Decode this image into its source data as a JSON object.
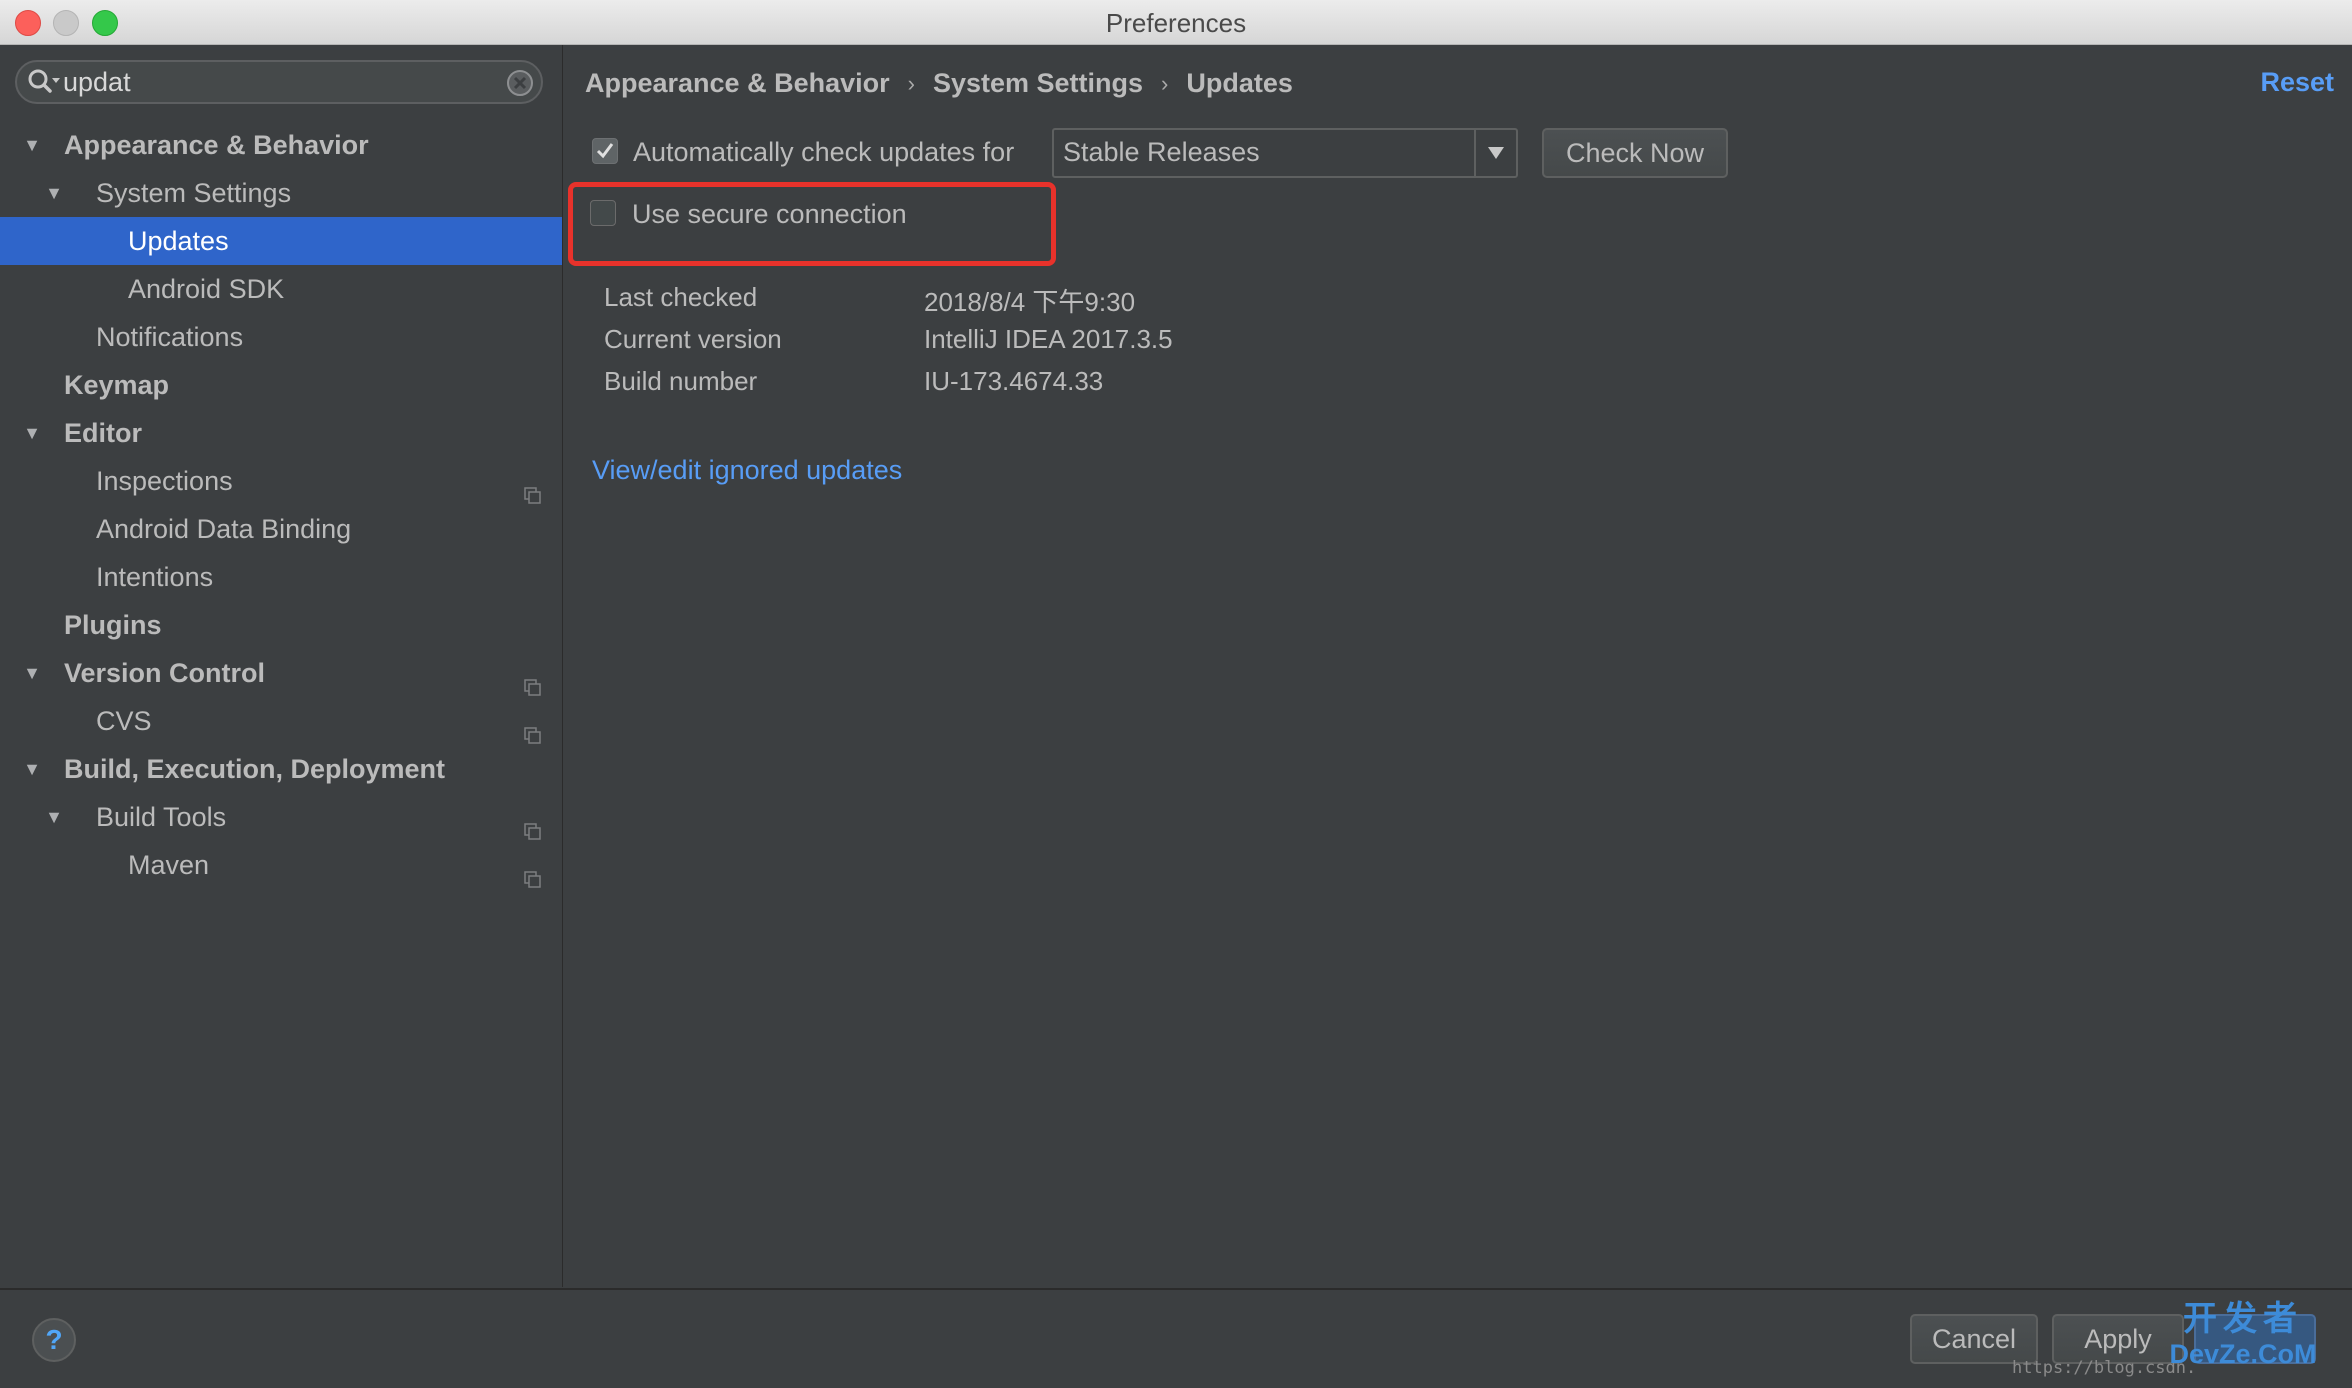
{
  "window": {
    "title": "Preferences"
  },
  "sidebar": {
    "search": {
      "value": "updat"
    },
    "items": [
      {
        "label": "Appearance & Behavior",
        "level": 0,
        "bold": true,
        "expanded": true
      },
      {
        "label": "System Settings",
        "level": 1,
        "bold": false,
        "expanded": true
      },
      {
        "label": "Updates",
        "level": 2,
        "bold": false,
        "selected": true
      },
      {
        "label": "Android SDK",
        "level": 2,
        "bold": false
      },
      {
        "label": "Notifications",
        "level": 1,
        "bold": false
      },
      {
        "label": "Keymap",
        "level": 0,
        "bold": true
      },
      {
        "label": "Editor",
        "level": 0,
        "bold": true,
        "expanded": true
      },
      {
        "label": "Inspections",
        "level": 1,
        "bold": false,
        "project_icon": true
      },
      {
        "label": "Android Data Binding",
        "level": 1,
        "bold": false
      },
      {
        "label": "Intentions",
        "level": 1,
        "bold": false
      },
      {
        "label": "Plugins",
        "level": 0,
        "bold": true
      },
      {
        "label": "Version Control",
        "level": 0,
        "bold": true,
        "expanded": true,
        "project_icon": true
      },
      {
        "label": "CVS",
        "level": 1,
        "bold": false,
        "project_icon": true
      },
      {
        "label": "Build, Execution, Deployment",
        "level": 0,
        "bold": true,
        "expanded": true
      },
      {
        "label": "Build Tools",
        "level": 1,
        "bold": false,
        "expanded": true,
        "project_icon": true
      },
      {
        "label": "Maven",
        "level": 2,
        "bold": false,
        "project_icon": true
      }
    ]
  },
  "main": {
    "breadcrumb": {
      "c1": "Appearance & Behavior",
      "c2": "System Settings",
      "c3": "Updates",
      "sep": "›"
    },
    "reset_label": "Reset",
    "auto_check": {
      "label": "Automatically check updates for",
      "checked": true
    },
    "channel": {
      "selected": "Stable Releases"
    },
    "check_now_label": "Check Now",
    "secure": {
      "label": "Use secure connection",
      "checked": false
    },
    "info": [
      {
        "key": "Last checked",
        "value": "2018/8/4 下午9:30"
      },
      {
        "key": "Current version",
        "value": "IntelliJ IDEA 2017.3.5"
      },
      {
        "key": "Build number",
        "value": "IU-173.4674.33"
      }
    ],
    "ignored_link": "View/edit ignored updates"
  },
  "footer": {
    "help_label": "?",
    "cancel_label": "Cancel",
    "apply_label": "Apply",
    "watermark": "https://blog.csdn.",
    "brand_top": "开发者",
    "brand_bottom": "DevZe.CoM"
  },
  "colors": {
    "accent": "#2f65ca",
    "link": "#589df6",
    "highlight": "#e8322b"
  }
}
